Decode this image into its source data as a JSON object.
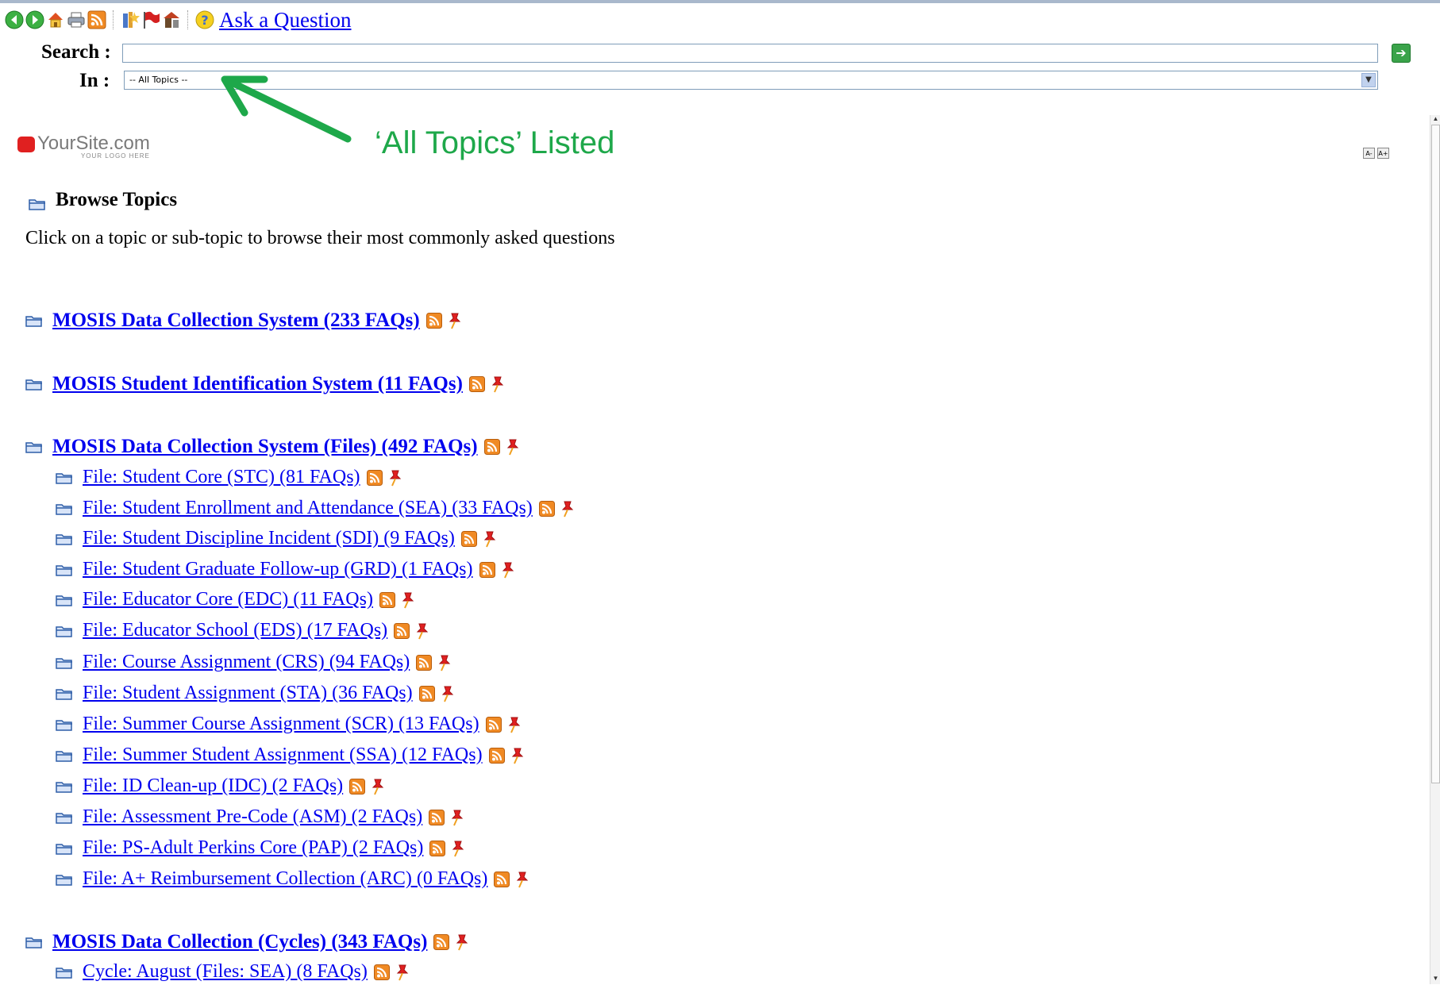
{
  "toolbar": {
    "ask_label": "Ask a Question",
    "icons": [
      "back-icon",
      "forward-icon",
      "home-icon",
      "print-icon",
      "rss-icon",
      "favorites-icon",
      "flag-icon",
      "tools-icon",
      "help-icon"
    ]
  },
  "search": {
    "label": "Search :",
    "value": "",
    "in_label": "In :",
    "in_selected": "-- All Topics --"
  },
  "annotation": {
    "text": "‘All Topics’ Listed",
    "color": "#1ea84a"
  },
  "logo": {
    "name": "YourSite.com",
    "tagline": "YOUR LOGO HERE"
  },
  "font_buttons": [
    "A-",
    "A+"
  ],
  "browse": {
    "title": "Browse Topics",
    "intro": "Click on a topic or sub-topic to browse their most commonly asked questions"
  },
  "topics": [
    {
      "label": "MOSIS Data Collection System (233 FAQs)",
      "level": "main"
    },
    {
      "label": "MOSIS Student Identification System (11 FAQs)",
      "level": "main"
    },
    {
      "label": "MOSIS Data Collection System (Files) (492 FAQs)",
      "level": "main"
    },
    {
      "label": "File: Student Core (STC) (81 FAQs)",
      "level": "sub"
    },
    {
      "label": "File: Student Enrollment and Attendance (SEA) (33 FAQs)",
      "level": "sub"
    },
    {
      "label": "File: Student Discipline Incident (SDI) (9 FAQs)",
      "level": "sub"
    },
    {
      "label": "File: Student Graduate Follow-up (GRD) (1 FAQs)",
      "level": "sub"
    },
    {
      "label": "File: Educator Core (EDC) (11 FAQs)",
      "level": "sub"
    },
    {
      "label": "File: Educator School (EDS) (17 FAQs)",
      "level": "sub"
    },
    {
      "label": "File: Course Assignment (CRS) (94 FAQs)",
      "level": "sub"
    },
    {
      "label": "File: Student Assignment (STA) (36 FAQs)",
      "level": "sub"
    },
    {
      "label": "File: Summer Course Assignment (SCR) (13 FAQs)",
      "level": "sub"
    },
    {
      "label": "File: Summer Student Assignment (SSA) (12 FAQs)",
      "level": "sub"
    },
    {
      "label": "File: ID Clean-up (IDC) (2 FAQs)",
      "level": "sub"
    },
    {
      "label": "File: Assessment Pre-Code (ASM) (2 FAQs)",
      "level": "sub"
    },
    {
      "label": "File: PS-Adult Perkins Core (PAP) (2 FAQs)",
      "level": "sub"
    },
    {
      "label": "File: A+ Reimbursement Collection (ARC) (0 FAQs)",
      "level": "sub"
    },
    {
      "label": "MOSIS Data Collection (Cycles) (343 FAQs)",
      "level": "main"
    },
    {
      "label": "Cycle: August (Files: SEA) (8 FAQs)",
      "level": "sub"
    }
  ]
}
